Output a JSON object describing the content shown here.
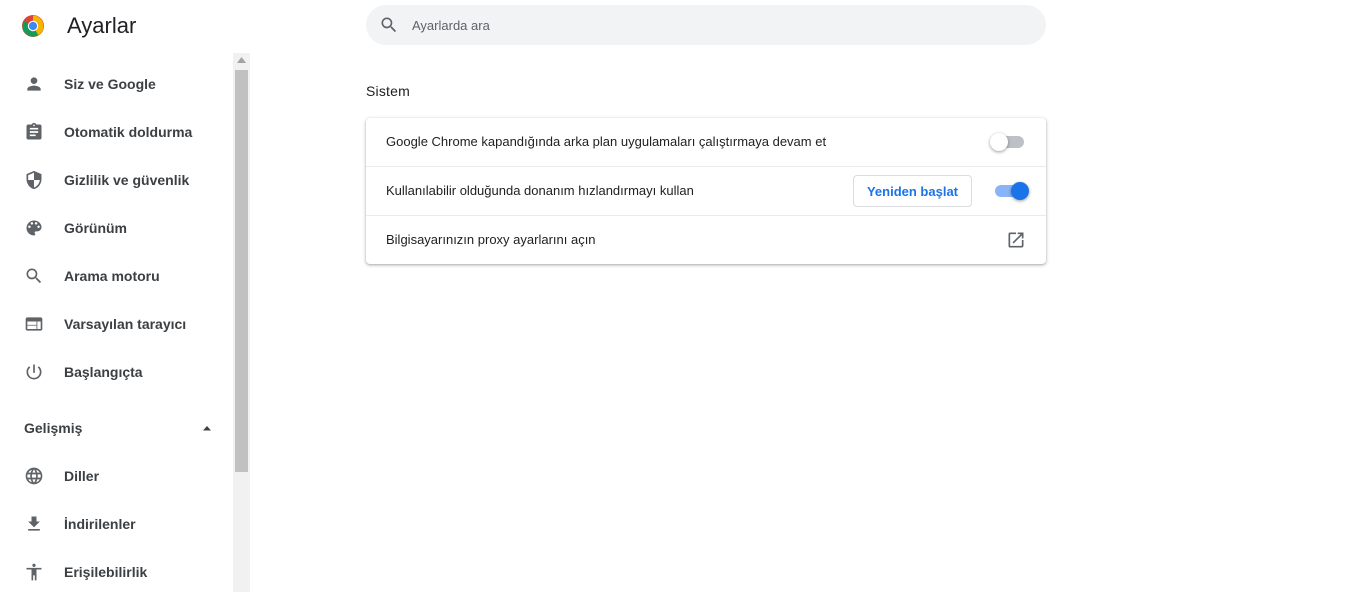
{
  "header": {
    "title": "Ayarlar"
  },
  "search": {
    "placeholder": "Ayarlarda ara"
  },
  "sidebar": {
    "items": [
      {
        "label": "Siz ve Google",
        "icon": "person-icon"
      },
      {
        "label": "Otomatik doldurma",
        "icon": "clipboard-icon"
      },
      {
        "label": "Gizlilik ve güvenlik",
        "icon": "shield-icon"
      },
      {
        "label": "Görünüm",
        "icon": "palette-icon"
      },
      {
        "label": "Arama motoru",
        "icon": "search-icon"
      },
      {
        "label": "Varsayılan tarayıcı",
        "icon": "browser-icon"
      },
      {
        "label": "Başlangıçta",
        "icon": "power-icon"
      }
    ],
    "advanced": {
      "label": "Gelişmiş",
      "expanded": true
    },
    "advanced_items": [
      {
        "label": "Diller",
        "icon": "globe-icon"
      },
      {
        "label": "İndirilenler",
        "icon": "download-icon"
      },
      {
        "label": "Erişilebilirlik",
        "icon": "accessibility-icon"
      }
    ]
  },
  "main": {
    "section_title": "Sistem",
    "rows": [
      {
        "label": "Google Chrome kapandığında arka plan uygulamaları çalıştırmaya devam et",
        "toggle": false
      },
      {
        "label": "Kullanılabilir olduğunda donanım hızlandırmayı kullan",
        "toggle": true,
        "button_label": "Yeniden başlat"
      },
      {
        "label": "Bilgisayarınızın proxy ayarlarını açın",
        "icon": "open-external-icon"
      }
    ]
  },
  "colors": {
    "accent": "#1a73e8",
    "accent_light": "#8ab4f8",
    "icon": "#5f6368",
    "text": "#202124"
  }
}
